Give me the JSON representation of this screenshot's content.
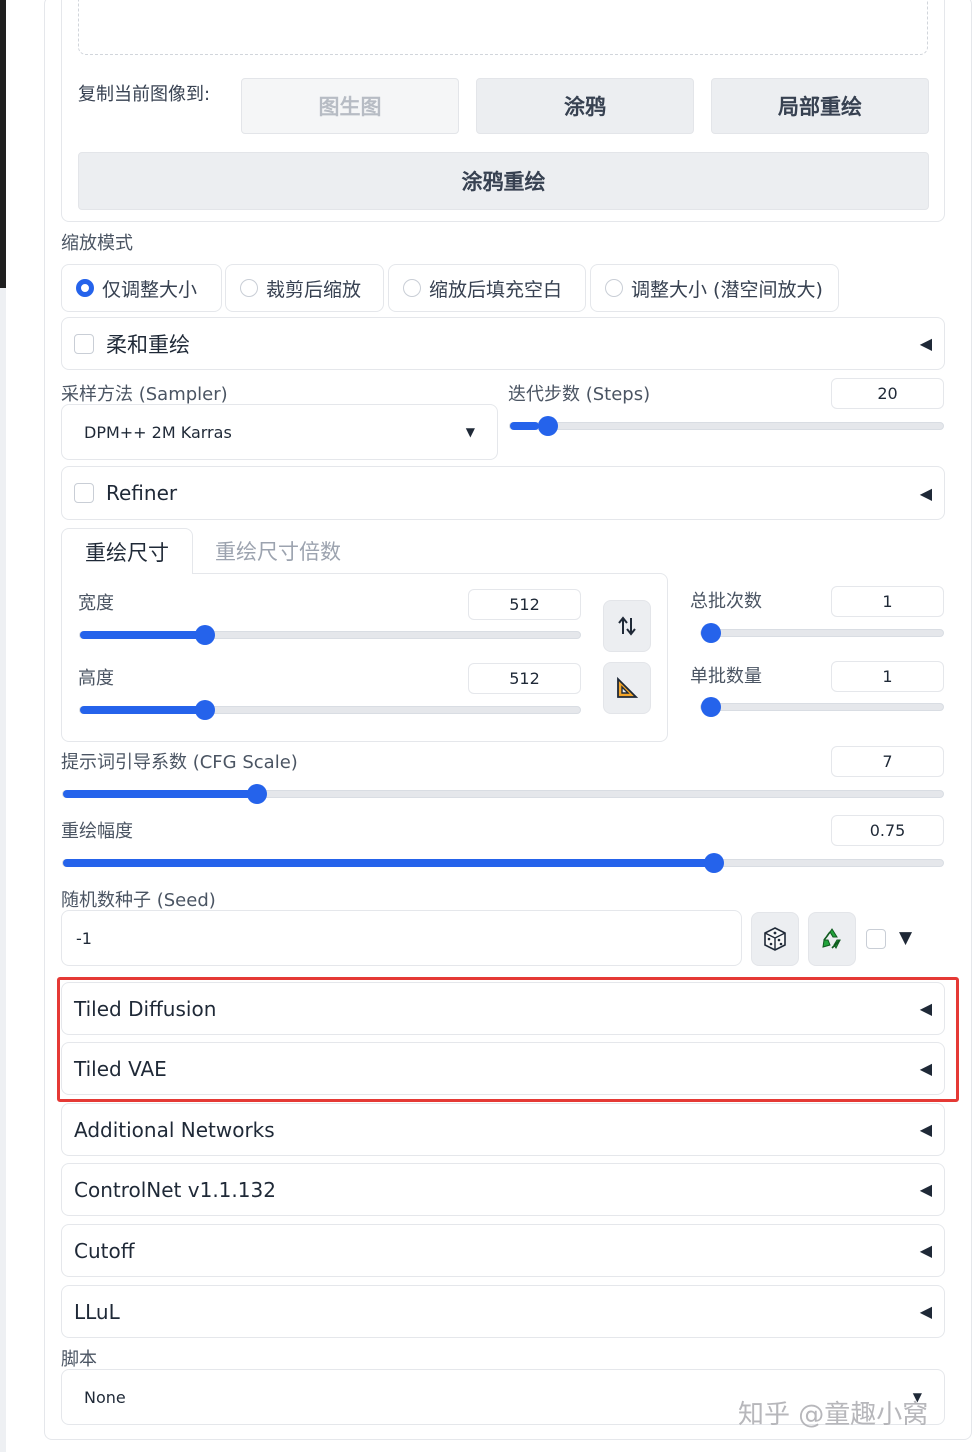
{
  "copy_image": {
    "label": "复制当前图像到:",
    "buttons": [
      "图生图",
      "涂鸦",
      "局部重绘"
    ],
    "wide_button": "涂鸦重绘"
  },
  "resize_mode": {
    "label": "缩放模式",
    "options": [
      "仅调整大小",
      "裁剪后缩放",
      "缩放后填充空白",
      "调整大小 (潜空间放大)"
    ],
    "selected": "仅调整大小"
  },
  "soft_inpainting": {
    "label": "柔和重绘"
  },
  "sampler": {
    "label": "采样方法 (Sampler)",
    "value": "DPM++ 2M Karras"
  },
  "steps": {
    "label": "迭代步数 (Steps)",
    "value": "20",
    "fraction": 0.068
  },
  "refiner": {
    "label": "Refiner"
  },
  "size_tabs": [
    "重绘尺寸",
    "重绘尺寸倍数"
  ],
  "width": {
    "label": "宽度",
    "value": "512",
    "fraction": 0.24
  },
  "height": {
    "label": "高度",
    "value": "512",
    "fraction": 0.24
  },
  "batch_count": {
    "label": "总批次数",
    "value": "1",
    "fraction": 0.0
  },
  "batch_size": {
    "label": "单批数量",
    "value": "1",
    "fraction": 0.0
  },
  "cfg_scale": {
    "label": "提示词引导系数 (CFG Scale)",
    "value": "7",
    "fraction": 0.214
  },
  "denoising": {
    "label": "重绘幅度",
    "value": "0.75",
    "fraction": 0.745
  },
  "seed": {
    "label": "随机数种子 (Seed)",
    "value": "-1"
  },
  "extensions": {
    "highlighted": [
      "Tiled Diffusion",
      "Tiled VAE"
    ],
    "others": [
      "Additional Networks",
      "ControlNet v1.1.132",
      "Cutoff",
      "LLuL"
    ]
  },
  "script": {
    "label": "脚本",
    "value": "None"
  },
  "watermark": "知乎 @童趣小窝",
  "colors": {
    "accent": "#2563eb",
    "highlight": "#e53935"
  }
}
